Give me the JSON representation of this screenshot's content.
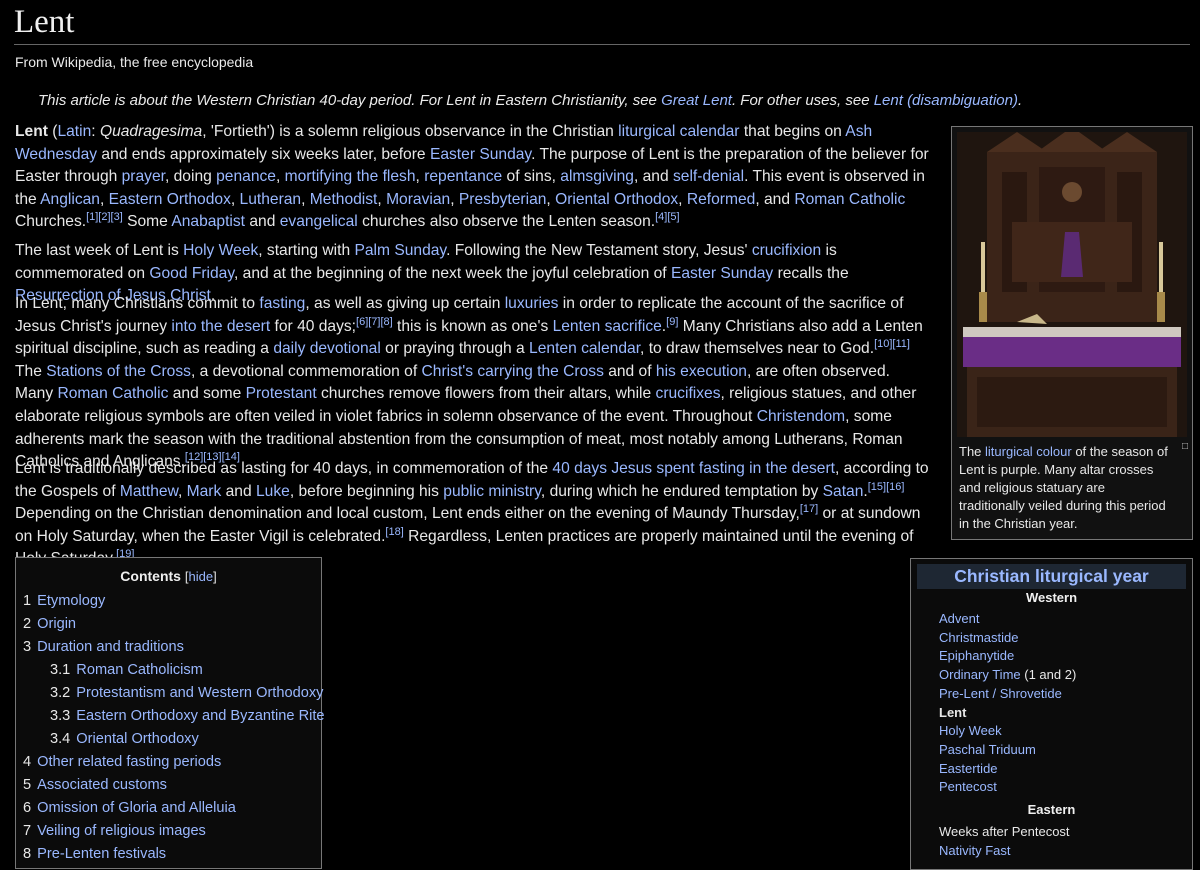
{
  "article": {
    "title": "Lent",
    "tagline": "From Wikipedia, the free encyclopedia",
    "hatnote": [
      {
        "t": "This article is about the Western Christian 40-day period. For Lent in Eastern Christianity, see "
      },
      {
        "t": "Great Lent",
        "link": true
      },
      {
        "t": ". For other uses, see "
      },
      {
        "t": "Lent (disambiguation)",
        "link": true
      },
      {
        "t": "."
      }
    ],
    "paragraphs": [
      [
        {
          "t": "Lent",
          "bold": true
        },
        {
          "t": " ("
        },
        {
          "t": "Latin",
          "link": true
        },
        {
          "t": ": "
        },
        {
          "t": "Quadragesima",
          "italic": true
        },
        {
          "t": ", 'Fortieth') is a solemn religious observance in the Christian "
        },
        {
          "t": "liturgical calendar",
          "link": true
        },
        {
          "t": " that begins on "
        },
        {
          "t": "Ash Wednesday",
          "link": true
        },
        {
          "t": " and ends approximately six weeks later, before "
        },
        {
          "t": "Easter Sunday",
          "link": true
        },
        {
          "t": ". The purpose of Lent is the preparation of the believer for Easter through "
        },
        {
          "t": "prayer",
          "link": true
        },
        {
          "t": ", doing "
        },
        {
          "t": "penance",
          "link": true
        },
        {
          "t": ", "
        },
        {
          "t": "mortifying the flesh",
          "link": true
        },
        {
          "t": ", "
        },
        {
          "t": "repentance",
          "link": true
        },
        {
          "t": " of sins, "
        },
        {
          "t": "almsgiving",
          "link": true
        },
        {
          "t": ", and "
        },
        {
          "t": "self-denial",
          "link": true
        },
        {
          "t": ". This event is observed in the "
        },
        {
          "t": "Anglican",
          "link": true
        },
        {
          "t": ", "
        },
        {
          "t": "Eastern Orthodox",
          "link": true
        },
        {
          "t": ", "
        },
        {
          "t": "Lutheran",
          "link": true
        },
        {
          "t": ", "
        },
        {
          "t": "Methodist",
          "link": true
        },
        {
          "t": ", "
        },
        {
          "t": "Moravian",
          "link": true
        },
        {
          "t": ", "
        },
        {
          "t": "Presbyterian",
          "link": true
        },
        {
          "t": ", "
        },
        {
          "t": "Oriental Orthodox",
          "link": true
        },
        {
          "t": ", "
        },
        {
          "t": "Reformed",
          "link": true
        },
        {
          "t": ", and "
        },
        {
          "t": "Roman Catholic",
          "link": true
        },
        {
          "t": " Churches."
        },
        {
          "t": "[1][2][3]",
          "sup": true
        },
        {
          "t": " Some "
        },
        {
          "t": "Anabaptist",
          "link": true
        },
        {
          "t": " and "
        },
        {
          "t": "evangelical",
          "link": true
        },
        {
          "t": " churches also observe the Lenten season."
        },
        {
          "t": "[4][5]",
          "sup": true
        }
      ],
      [
        {
          "t": "The last week of Lent is "
        },
        {
          "t": "Holy Week",
          "link": true
        },
        {
          "t": ", starting with "
        },
        {
          "t": "Palm Sunday",
          "link": true
        },
        {
          "t": ". Following the New Testament story, Jesus' "
        },
        {
          "t": "crucifixion",
          "link": true
        },
        {
          "t": " is commemorated on "
        },
        {
          "t": "Good Friday",
          "link": true
        },
        {
          "t": ", and at the beginning of the next week the joyful celebration of "
        },
        {
          "t": "Easter Sunday",
          "link": true
        },
        {
          "t": " recalls the "
        },
        {
          "t": "Resurrection of Jesus Christ",
          "link": true
        },
        {
          "t": "."
        }
      ],
      [
        {
          "t": "In Lent, many Christians commit to "
        },
        {
          "t": "fasting",
          "link": true
        },
        {
          "t": ", as well as giving up certain "
        },
        {
          "t": "luxuries",
          "link": true
        },
        {
          "t": " in order to replicate the account of the sacrifice of Jesus Christ's journey "
        },
        {
          "t": "into the desert",
          "link": true
        },
        {
          "t": " for 40 days;"
        },
        {
          "t": "[6][7][8]",
          "sup": true
        },
        {
          "t": " this is known as one's "
        },
        {
          "t": "Lenten sacrifice",
          "link": true
        },
        {
          "t": "."
        },
        {
          "t": "[9]",
          "sup": true
        },
        {
          "t": " Many Christians also add a Lenten spiritual discipline, such as reading a "
        },
        {
          "t": "daily devotional",
          "link": true
        },
        {
          "t": " or praying through a "
        },
        {
          "t": "Lenten calendar",
          "link": true
        },
        {
          "t": ", to draw themselves near to God."
        },
        {
          "t": "[10][11]",
          "sup": true
        },
        {
          "t": " The "
        },
        {
          "t": "Stations of the Cross",
          "link": true
        },
        {
          "t": ", a devotional commemoration of "
        },
        {
          "t": "Christ's carrying the Cross",
          "link": true
        },
        {
          "t": " and of "
        },
        {
          "t": "his execution",
          "link": true
        },
        {
          "t": ", are often observed. Many "
        },
        {
          "t": "Roman Catholic",
          "link": true
        },
        {
          "t": " and some "
        },
        {
          "t": "Protestant",
          "link": true
        },
        {
          "t": " churches remove flowers from their altars, while "
        },
        {
          "t": "crucifixes",
          "link": true
        },
        {
          "t": ", religious statues, and other elaborate religious symbols are often veiled in violet fabrics in solemn observance of the event. Throughout "
        },
        {
          "t": "Christendom",
          "link": true
        },
        {
          "t": ", some adherents mark the season with the traditional abstention from the consumption of meat, most notably among Lutherans, Roman Catholics and Anglicans."
        },
        {
          "t": "[12][13][14]",
          "sup": true
        }
      ],
      [
        {
          "t": "Lent is traditionally described as lasting for 40 days, in commemoration of the "
        },
        {
          "t": "40 days Jesus spent fasting in the desert",
          "link": true
        },
        {
          "t": ", according to the Gospels of "
        },
        {
          "t": "Matthew",
          "link": true
        },
        {
          "t": ", "
        },
        {
          "t": "Mark",
          "link": true
        },
        {
          "t": " and "
        },
        {
          "t": "Luke",
          "link": true
        },
        {
          "t": ", before beginning his "
        },
        {
          "t": "public ministry",
          "link": true
        },
        {
          "t": ", during which he endured temptation by "
        },
        {
          "t": "Satan",
          "link": true
        },
        {
          "t": "."
        },
        {
          "t": "[15][16]",
          "sup": true
        },
        {
          "t": " Depending on the Christian denomination and local custom, Lent ends either on the evening of Maundy Thursday,"
        },
        {
          "t": "[17]",
          "sup": true
        },
        {
          "t": " or at sundown on Holy Saturday, when the Easter Vigil is celebrated."
        },
        {
          "t": "[18]",
          "sup": true
        },
        {
          "t": " Regardless, Lenten practices are properly maintained until the evening of Holy Saturday."
        },
        {
          "t": "[19]",
          "sup": true
        }
      ]
    ]
  },
  "thumbnail": {
    "caption": [
      {
        "t": "The "
      },
      {
        "t": "liturgical colour",
        "link": true
      },
      {
        "t": " of the season of Lent is purple. Many altar crosses and religious statuary are traditionally veiled during this period in the Christian year."
      }
    ],
    "altar_cloth_color": "#6a2d86"
  },
  "toc": {
    "title": "Contents",
    "hide_open": "[",
    "hide_label": "hide",
    "hide_close": "]",
    "items": [
      {
        "num": "1",
        "label": "Etymology"
      },
      {
        "num": "2",
        "label": "Origin"
      },
      {
        "num": "3",
        "label": "Duration and traditions"
      },
      {
        "num": "3.1",
        "label": "Roman Catholicism"
      },
      {
        "num": "3.2",
        "label": "Protestantism and Western Orthodoxy"
      },
      {
        "num": "3.3",
        "label": "Eastern Orthodoxy and Byzantine Rite"
      },
      {
        "num": "3.4",
        "label": "Oriental Orthodoxy"
      },
      {
        "num": "4",
        "label": "Other related fasting periods"
      },
      {
        "num": "5",
        "label": "Associated customs"
      },
      {
        "num": "6",
        "label": "Omission of Gloria and Alleluia"
      },
      {
        "num": "7",
        "label": "Veiling of religious images"
      },
      {
        "num": "8",
        "label": "Pre-Lenten festivals"
      }
    ]
  },
  "infobox": {
    "title": "Christian liturgical year",
    "western_heading": "Western",
    "western_items": [
      {
        "label": "Advent",
        "link": true
      },
      {
        "label": "Christmastide",
        "link": true
      },
      {
        "label": "Epiphanytide",
        "link": true
      },
      {
        "label": "Ordinary Time",
        "link": true,
        "suffix": " (1 and 2)"
      },
      {
        "label": "Pre-Lent / Shrovetide",
        "link": true
      },
      {
        "label": "Lent",
        "bold": true
      },
      {
        "label": "Holy Week",
        "link": true
      },
      {
        "label": "Paschal Triduum",
        "link": true
      },
      {
        "label": "Eastertide",
        "link": true
      },
      {
        "label": "Pentecost",
        "link": true
      }
    ],
    "eastern_heading": "Eastern",
    "eastern_items": [
      {
        "label": "Weeks after Pentecost"
      },
      {
        "label": "Nativity Fast",
        "link": true
      }
    ]
  },
  "colors": {
    "background": "#000000",
    "text": "#e8e8e8",
    "link": "#9ab8ff",
    "infobox_title_bg": "#1e2733"
  }
}
